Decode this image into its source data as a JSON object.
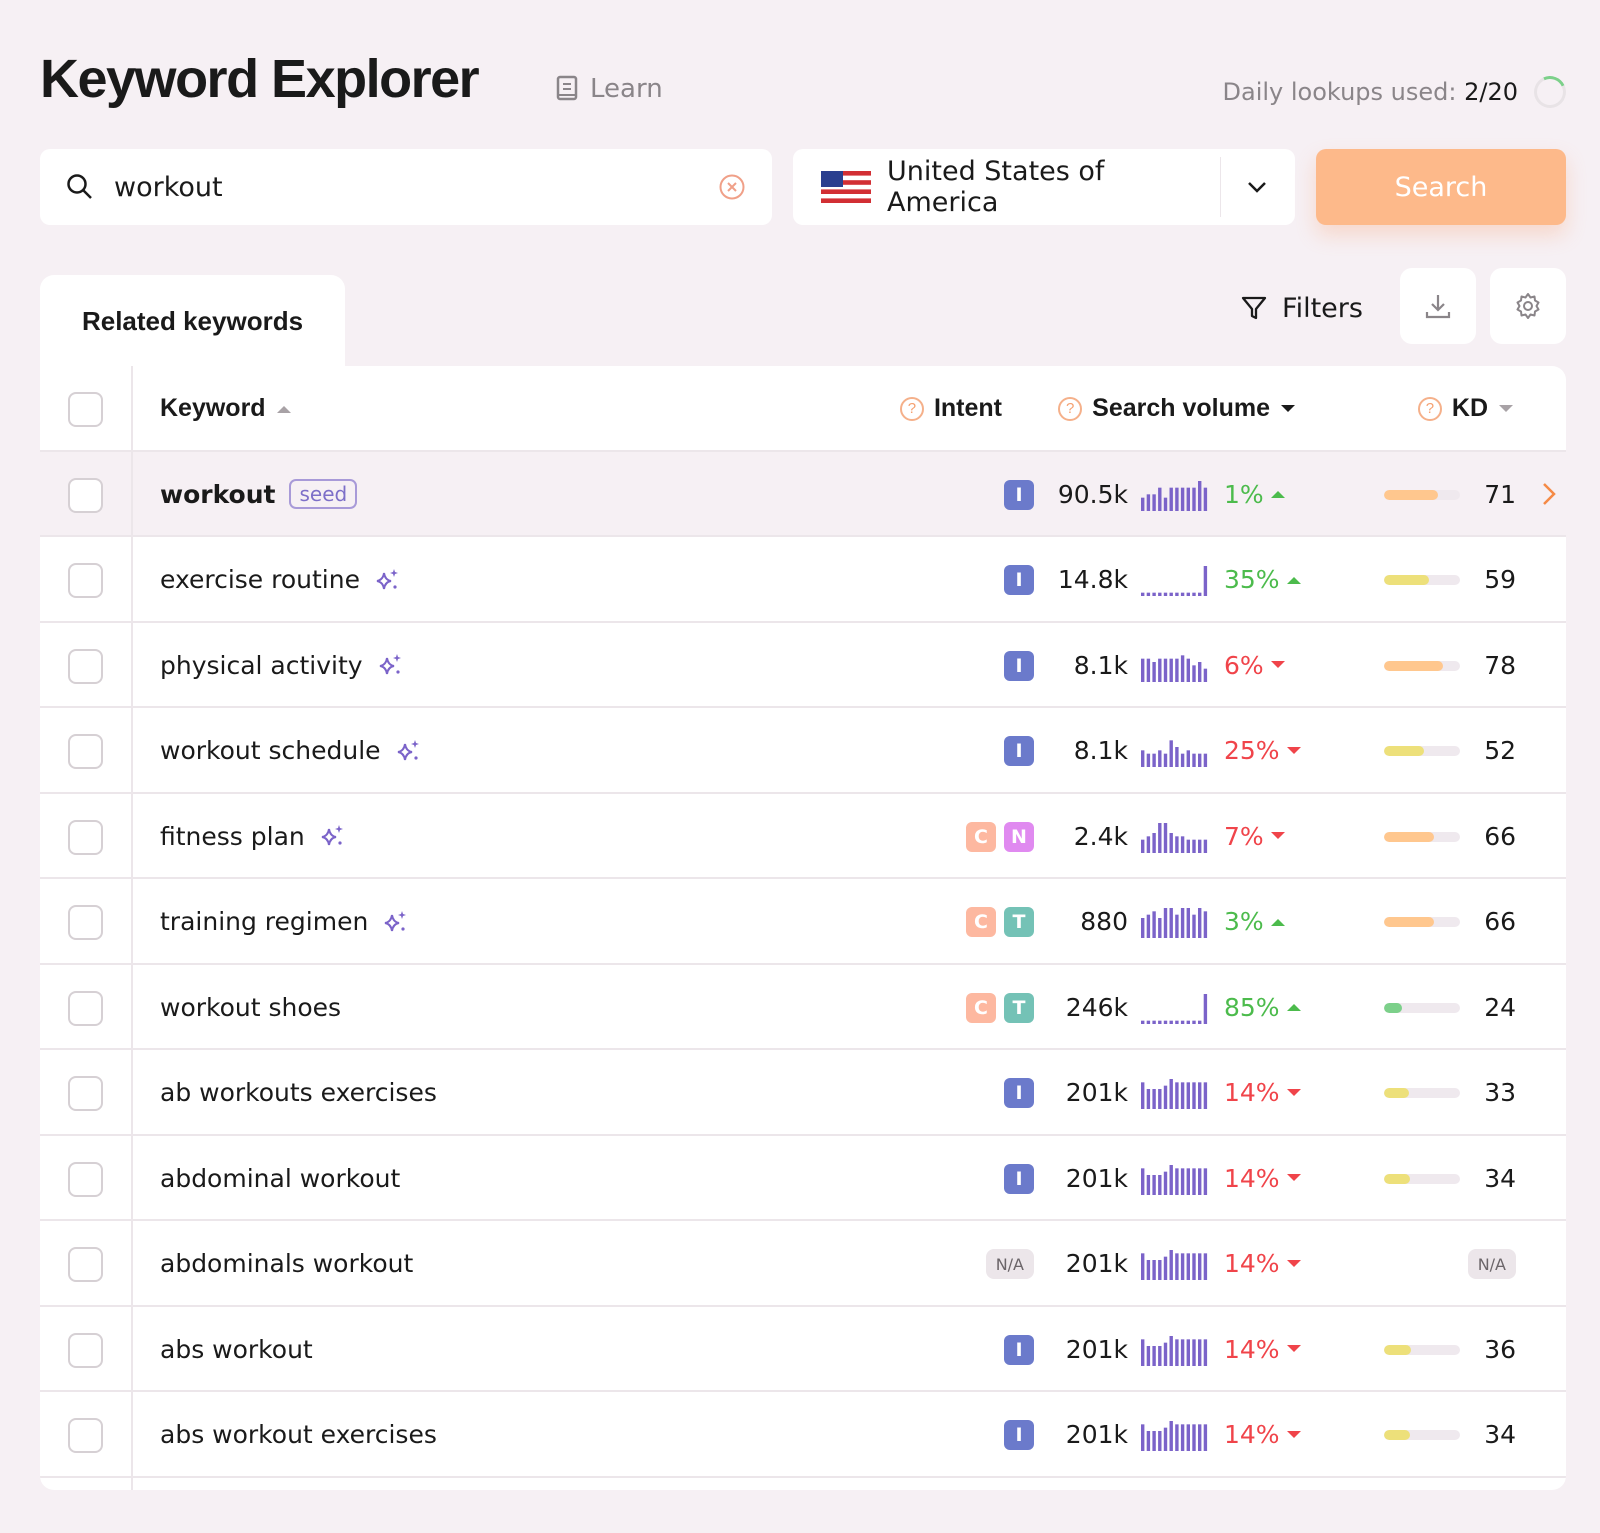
{
  "header": {
    "title": "Keyword Explorer",
    "learn": "Learn",
    "lookups_label": "Daily lookups used:",
    "lookups_value": "2/20",
    "lookups_fraction": 0.1
  },
  "search": {
    "value": "workout",
    "country": "United States of America",
    "button": "Search"
  },
  "tabs": [
    {
      "label": "Related keywords",
      "active": true
    }
  ],
  "toolbar": {
    "filters": "Filters"
  },
  "columns": {
    "keyword": "Keyword",
    "intent": "Intent",
    "volume": "Search volume",
    "kd": "KD"
  },
  "colors": {
    "I": "#6b7acb",
    "C": "#fdb8a0",
    "N": "#e08af0",
    "T": "#74c2b6",
    "spark": "#7b63c9",
    "up": "#4cbb4c",
    "down": "#f0444a"
  },
  "seed_label": "seed",
  "rows": [
    {
      "keyword": "workout",
      "seed": true,
      "ai": false,
      "intent": [
        "I"
      ],
      "volume": "90.5k",
      "trend": [
        4,
        5,
        5,
        7,
        4,
        7,
        7,
        7,
        7,
        7,
        9,
        7
      ],
      "change": "1%",
      "dir": "up",
      "kd": 71,
      "kd_color": "#ffc78e"
    },
    {
      "keyword": "exercise routine",
      "ai": true,
      "intent": [
        "I"
      ],
      "volume": "14.8k",
      "trend": [
        1,
        1,
        1,
        1,
        1,
        1,
        1,
        1,
        1,
        1,
        1,
        9
      ],
      "change": "35%",
      "dir": "up",
      "kd": 59,
      "kd_color": "#ede07a"
    },
    {
      "keyword": "physical activity",
      "ai": true,
      "intent": [
        "I"
      ],
      "volume": "8.1k",
      "trend": [
        7,
        7,
        6,
        7,
        7,
        7,
        7,
        8,
        7,
        5,
        6,
        4
      ],
      "change": "6%",
      "dir": "down",
      "kd": 78,
      "kd_color": "#ffc78e"
    },
    {
      "keyword": "workout schedule",
      "ai": true,
      "intent": [
        "I"
      ],
      "volume": "8.1k",
      "trend": [
        5,
        4,
        4,
        5,
        4,
        8,
        6,
        4,
        5,
        4,
        4,
        4
      ],
      "change": "25%",
      "dir": "down",
      "kd": 52,
      "kd_color": "#ede07a"
    },
    {
      "keyword": "fitness plan",
      "ai": true,
      "intent": [
        "C",
        "N"
      ],
      "volume": "2.4k",
      "trend": [
        4,
        5,
        6,
        9,
        9,
        6,
        5,
        5,
        4,
        4,
        4,
        4
      ],
      "change": "7%",
      "dir": "down",
      "kd": 66,
      "kd_color": "#ffc78e"
    },
    {
      "keyword": "training regimen",
      "ai": true,
      "intent": [
        "C",
        "T"
      ],
      "volume": "880",
      "trend": [
        6,
        7,
        8,
        6,
        9,
        9,
        7,
        9,
        9,
        7,
        9,
        8
      ],
      "change": "3%",
      "dir": "up",
      "kd": 66,
      "kd_color": "#ffc78e"
    },
    {
      "keyword": "workout shoes",
      "ai": false,
      "intent": [
        "C",
        "T"
      ],
      "volume": "246k",
      "trend": [
        1,
        1,
        1,
        1,
        1,
        1,
        1,
        1,
        1,
        1,
        1,
        9
      ],
      "change": "85%",
      "dir": "up",
      "kd": 24,
      "kd_color": "#7cd08a"
    },
    {
      "keyword": "ab workouts exercises",
      "ai": false,
      "intent": [
        "I"
      ],
      "volume": "201k",
      "trend": [
        8,
        6,
        6,
        6,
        7,
        9,
        8,
        8,
        8,
        8,
        8,
        8
      ],
      "change": "14%",
      "dir": "down",
      "kd": 33,
      "kd_color": "#ede07a"
    },
    {
      "keyword": "abdominal workout",
      "ai": false,
      "intent": [
        "I"
      ],
      "volume": "201k",
      "trend": [
        8,
        6,
        6,
        6,
        7,
        9,
        8,
        8,
        8,
        8,
        8,
        8
      ],
      "change": "14%",
      "dir": "down",
      "kd": 34,
      "kd_color": "#ede07a"
    },
    {
      "keyword": "abdominals workout",
      "ai": false,
      "intent": [],
      "intent_na": "N/A",
      "volume": "201k",
      "trend": [
        8,
        6,
        6,
        6,
        7,
        9,
        8,
        8,
        8,
        8,
        8,
        8
      ],
      "change": "14%",
      "dir": "down",
      "kd": null,
      "kd_na": "N/A"
    },
    {
      "keyword": "abs workout",
      "ai": false,
      "intent": [
        "I"
      ],
      "volume": "201k",
      "trend": [
        8,
        6,
        6,
        6,
        7,
        9,
        8,
        8,
        8,
        8,
        8,
        8
      ],
      "change": "14%",
      "dir": "down",
      "kd": 36,
      "kd_color": "#ede07a"
    },
    {
      "keyword": "abs workout exercises",
      "ai": false,
      "intent": [
        "I"
      ],
      "volume": "201k",
      "trend": [
        8,
        6,
        6,
        6,
        7,
        9,
        8,
        8,
        8,
        8,
        8,
        8
      ],
      "change": "14%",
      "dir": "down",
      "kd": 34,
      "kd_color": "#ede07a"
    }
  ]
}
